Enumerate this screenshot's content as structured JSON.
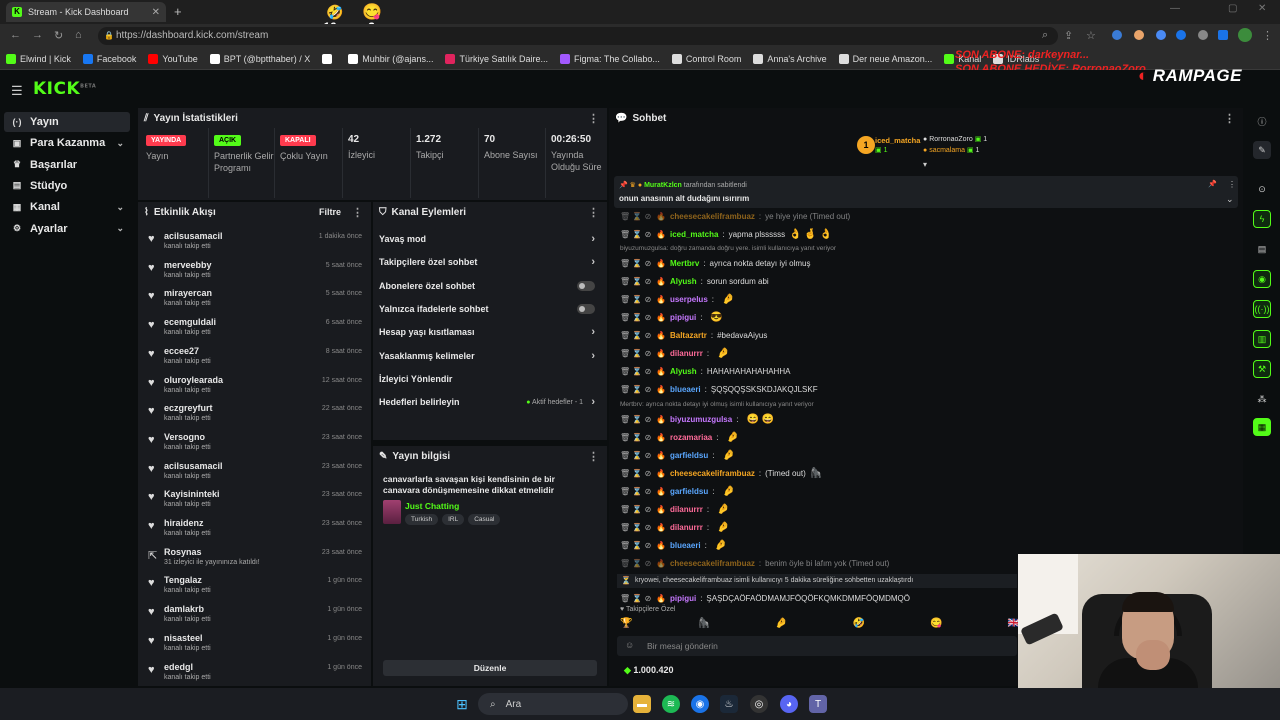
{
  "browser": {
    "tab_title": "Stream - Kick Dashboard",
    "url": "https://dashboard.kick.com/stream",
    "bookmarks": [
      {
        "label": "Elwind | Kick",
        "color": "#53fc18"
      },
      {
        "label": "Facebook",
        "color": "#1877f2"
      },
      {
        "label": "YouTube",
        "color": "#ff0000"
      },
      {
        "label": "BPT (@bptthaber) / X",
        "color": "#ffffff"
      },
      {
        "label": "",
        "color": "#ffffff"
      },
      {
        "label": "Muhbir (@ajans...",
        "color": "#ffffff"
      },
      {
        "label": "Türkiye Satılık Daire...",
        "color": "#e0245e"
      },
      {
        "label": "Figma: The Collabo...",
        "color": "#a259ff"
      },
      {
        "label": "Control Room",
        "color": "#dddddd"
      },
      {
        "label": "Anna's Archive",
        "color": "#dddddd"
      },
      {
        "label": "Der neue Amazon...",
        "color": "#dddddd"
      },
      {
        "label": "Kanal",
        "color": "#53fc18"
      },
      {
        "label": "IDRlabs",
        "color": "#dddddd"
      }
    ]
  },
  "overlay": {
    "combo1": "x10",
    "combo2": "x3",
    "sub_line1": "SON ABONE: darkeynar...",
    "sub_line2": "SON ABONE HEDİYE: RorronaoZoro",
    "brand": "RAMPAGE"
  },
  "kick": {
    "logo": "KICK",
    "logo_tag": "BETA"
  },
  "nav": [
    {
      "label": "Yayın",
      "icon": "(·)",
      "active": true,
      "chevron": false
    },
    {
      "label": "Para Kazanma",
      "icon": "▣",
      "active": false,
      "chevron": true
    },
    {
      "label": "Başarılar",
      "icon": "♛",
      "active": false,
      "chevron": false
    },
    {
      "label": "Stüdyo",
      "icon": "▤",
      "active": false,
      "chevron": false
    },
    {
      "label": "Kanal",
      "icon": "▦",
      "active": false,
      "chevron": true
    },
    {
      "label": "Ayarlar",
      "icon": "⚙",
      "active": false,
      "chevron": true
    }
  ],
  "stats": {
    "title": "Yayın İstatistikleri",
    "items": [
      {
        "badge": "YAYINDA",
        "badge_bg": "#ff3b4e",
        "label": "Yayın"
      },
      {
        "badge": "AÇIK",
        "badge_bg": "#53fc18",
        "label": "Partnerlik Gelir Programı"
      },
      {
        "badge": "KAPALI",
        "badge_bg": "#ff3b4e",
        "label": "Çoklu Yayın"
      },
      {
        "value": "42",
        "label": "İzleyici"
      },
      {
        "value": "1.272",
        "label": "Takipçi"
      },
      {
        "value": "70",
        "label": "Abone Sayısı"
      },
      {
        "value": "00:26:50",
        "label": "Yayında Olduğu Süre"
      }
    ]
  },
  "activity": {
    "title": "Etkinlik Akışı",
    "filter": "Filtre",
    "items": [
      {
        "name": "acilsusamacil",
        "sub": "kanalı takip etti",
        "time": "1 dakika önce"
      },
      {
        "name": "merveebby",
        "sub": "kanalı takip etti",
        "time": "5 saat önce"
      },
      {
        "name": "mirayercan",
        "sub": "kanalı takip etti",
        "time": "5 saat önce"
      },
      {
        "name": "ecemguldali",
        "sub": "kanalı takip etti",
        "time": "6 saat önce"
      },
      {
        "name": "eccee27",
        "sub": "kanalı takip etti",
        "time": "8 saat önce"
      },
      {
        "name": "oluroylearada",
        "sub": "kanalı takip etti",
        "time": "12 saat önce"
      },
      {
        "name": "eczgreyfurt",
        "sub": "kanalı takip etti",
        "time": "22 saat önce"
      },
      {
        "name": "Versogno",
        "sub": "kanalı takip etti",
        "time": "23 saat önce"
      },
      {
        "name": "acilsusamacil",
        "sub": "kanalı takip etti",
        "time": "23 saat önce"
      },
      {
        "name": "Kayisininteki",
        "sub": "kanalı takip etti",
        "time": "23 saat önce"
      },
      {
        "name": "hiraidenz",
        "sub": "kanalı takip etti",
        "time": "23 saat önce"
      },
      {
        "name": "Rosynas",
        "sub": "31 izleyici ile yayınınıza katıldı!",
        "time": "23 saat önce"
      },
      {
        "name": "Tengalaz",
        "sub": "kanalı takip etti",
        "time": "1 gün önce"
      },
      {
        "name": "damlakrb",
        "sub": "kanalı takip etti",
        "time": "1 gün önce"
      },
      {
        "name": "nisasteel",
        "sub": "kanalı takip etti",
        "time": "1 gün önce"
      },
      {
        "name": "ededgl",
        "sub": "kanalı takip etti",
        "time": "1 gün önce"
      }
    ]
  },
  "actions": {
    "title": "Kanal Eylemleri",
    "items": [
      {
        "label": "Yavaş mod",
        "kind": "chevron"
      },
      {
        "label": "Takipçilere özel sohbet",
        "kind": "chevron"
      },
      {
        "label": "Abonelere özel sohbet",
        "kind": "toggle"
      },
      {
        "label": "Yalnızca ifadelerle sohbet",
        "kind": "toggle"
      },
      {
        "label": "Hesap yaşı kısıtlaması",
        "kind": "chevron"
      },
      {
        "label": "Yasaklanmış kelimeler",
        "kind": "chevron"
      },
      {
        "label": "İzleyici Yönlendir",
        "kind": "none"
      },
      {
        "label": "Hedefleri belirleyin",
        "kind": "chevron",
        "extra": "Aktif hedefler - 1"
      }
    ]
  },
  "streaminfo": {
    "title": "Yayın bilgisi",
    "text": "canavarlarla savaşan kişi kendisinin de bir canavara dönüşmemesine dikkat etmelidir",
    "category": "Just Chatting",
    "tags": [
      "Turkish",
      "IRL",
      "Casual"
    ],
    "edit": "Düzenle"
  },
  "chat": {
    "title": "Sohbet",
    "top_gifters": [
      {
        "name": "iced_matcha",
        "count": "1"
      },
      {
        "name": "RorronaoZoro",
        "count": "1"
      },
      {
        "name": "sacmalama",
        "count": "1"
      }
    ],
    "pinned_by": "MuratKzlcn",
    "pinned_suffix": "tarafından sabitlendi",
    "pinned_text": "onun anasının alt dudağını ısırırım",
    "messages": [
      {
        "type": "msg",
        "user": "cheesecakeliframbuaz",
        "color": "#f5a623",
        "text": "ye hiye yine (Timed out)",
        "muted": true
      },
      {
        "type": "msg",
        "user": "iced_matcha",
        "color": "#53fc18",
        "text": "yapma plssssss",
        "emotes": "👌 🤞 👌"
      },
      {
        "type": "reply",
        "text": "biyuzumuzgulsa: doğru zamanda doğru yere. isimli kullanıcıya yanıt veriyor"
      },
      {
        "type": "msg",
        "user": "Mertbrv",
        "color": "#53fc18",
        "text": "ayrıca nokta detayı iyi olmuş"
      },
      {
        "type": "msg",
        "user": "Alyush",
        "color": "#53fc18",
        "text": "sorun sordum abi"
      },
      {
        "type": "msg",
        "user": "userpelus",
        "color": "#c678ff",
        "text": "",
        "emotes": "🤌"
      },
      {
        "type": "msg",
        "user": "pipigui",
        "color": "#c678ff",
        "text": "",
        "emotes": "😎"
      },
      {
        "type": "msg",
        "user": "Baltazartr",
        "color": "#f5a623",
        "text": "#bedavaAiyus"
      },
      {
        "type": "msg",
        "user": "dilanurrr",
        "color": "#ff6b9a",
        "text": "",
        "emotes": "🤌"
      },
      {
        "type": "msg",
        "user": "Alyush",
        "color": "#53fc18",
        "text": "HAHAHAHAHAHAHHA"
      },
      {
        "type": "msg",
        "user": "blueaeri",
        "color": "#5aa7ff",
        "text": "ŞQŞQQŞSKSKDJAKQJLSKF"
      },
      {
        "type": "reply",
        "text": "Mertbrv: ayrıca nokta detayı iyi olmuş isimli kullanıcıya yanıt veriyor"
      },
      {
        "type": "msg",
        "user": "biyuzumuzgulsa",
        "color": "#c678ff",
        "text": "",
        "emotes": "😄 😄"
      },
      {
        "type": "msg",
        "user": "rozamariaa",
        "color": "#ff6b9a",
        "text": "",
        "emotes": "🤌"
      },
      {
        "type": "msg",
        "user": "garfieldsu",
        "color": "#5aa7ff",
        "text": "",
        "emotes": "🤌"
      },
      {
        "type": "msg",
        "user": "cheesecakeliframbuaz",
        "color": "#f5a623",
        "text": "(Timed out)",
        "emotes": "🦍"
      },
      {
        "type": "msg",
        "user": "garfieldsu",
        "color": "#5aa7ff",
        "text": "",
        "emotes": "🤌"
      },
      {
        "type": "msg",
        "user": "dilanurrr",
        "color": "#ff6b9a",
        "text": "",
        "emotes": "🤌"
      },
      {
        "type": "msg",
        "user": "dilanurrr",
        "color": "#ff6b9a",
        "text": "",
        "emotes": "🤌"
      },
      {
        "type": "msg",
        "user": "blueaeri",
        "color": "#5aa7ff",
        "text": "",
        "emotes": "🤌"
      },
      {
        "type": "msg",
        "user": "cheesecakeliframbuaz",
        "color": "#f5a623",
        "text": "benim öyle bi lafım yok (Timed out)",
        "muted": true
      },
      {
        "type": "system",
        "text": "kryowei, cheesecakeliframbuaz isimli kullanıcıyı 5 dakika süreliğine sohbetten uzaklaştırdı"
      },
      {
        "type": "msg",
        "user": "pipigui",
        "color": "#c678ff",
        "text": "ŞAŞDÇAÖFAÖDMAMJFÖQÖFKQMKDMMFÖQMDMQÖ"
      }
    ],
    "followers_only": "Takipçilere Özel",
    "placeholder": "Bir mesaj gönderin",
    "balance": "1.000.420"
  },
  "taskbar": {
    "search": "Ara"
  }
}
